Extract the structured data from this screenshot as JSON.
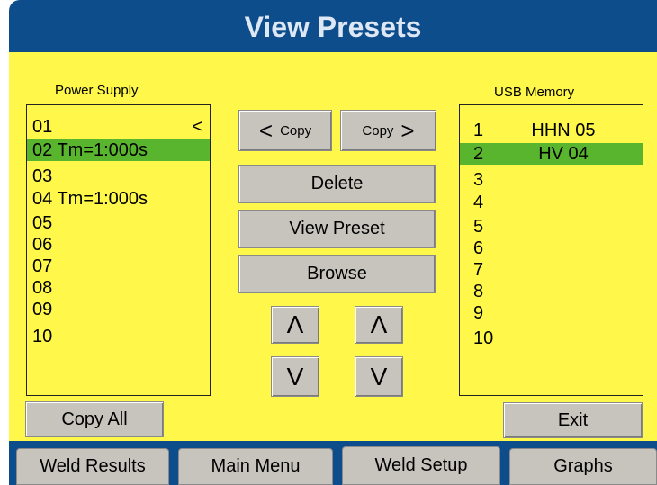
{
  "header": {
    "title": "View Presets"
  },
  "power_supply": {
    "label": "Power Supply",
    "items": [
      {
        "text": "01",
        "marker": "<"
      },
      {
        "text": "02 Tm=1:000s",
        "marker": ""
      },
      {
        "text": "03",
        "marker": ""
      },
      {
        "text": "04 Tm=1:000s",
        "marker": ""
      },
      {
        "text": "05",
        "marker": ""
      },
      {
        "text": "06",
        "marker": ""
      },
      {
        "text": "07",
        "marker": ""
      },
      {
        "text": "08",
        "marker": ""
      },
      {
        "text": "09",
        "marker": ""
      },
      {
        "text": "10",
        "marker": ""
      }
    ],
    "selected_index": 1
  },
  "usb_memory": {
    "label": "USB Memory",
    "items": [
      {
        "num": "1",
        "name": "HHN 05"
      },
      {
        "num": "2",
        "name": "HV 04"
      },
      {
        "num": "3",
        "name": ""
      },
      {
        "num": "4",
        "name": ""
      },
      {
        "num": "5",
        "name": ""
      },
      {
        "num": "6",
        "name": ""
      },
      {
        "num": "7",
        "name": ""
      },
      {
        "num": "8",
        "name": ""
      },
      {
        "num": "9",
        "name": ""
      },
      {
        "num": "10",
        "name": ""
      }
    ],
    "selected_index": 1
  },
  "buttons": {
    "copy_left": {
      "arrow": "<",
      "label": "Copy"
    },
    "copy_right": {
      "arrow": ">",
      "label": "Copy"
    },
    "delete": "Delete",
    "view_preset": "View Preset",
    "browse": "Browse",
    "up_glyph": "Λ",
    "down_glyph": "V",
    "copy_all": "Copy All",
    "exit": "Exit"
  },
  "tabs": [
    "Weld Results",
    "Main Menu",
    "Weld Setup",
    "Graphs"
  ],
  "colors": {
    "header_bg": "#0e4d8c",
    "panel_bg": "#fff84a",
    "selected_row": "#5ab52e",
    "button_bg": "#c6c4bd"
  }
}
